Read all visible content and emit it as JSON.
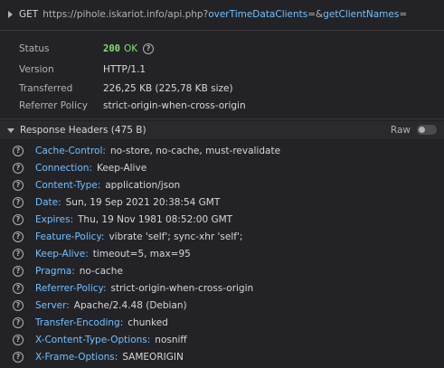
{
  "request": {
    "method": "GET",
    "url_base": "https://pihole.iskariot.info/api.php?",
    "param1": "overTimeDataClients",
    "eq1": "=&",
    "param2": "getClientNames",
    "eq2": "="
  },
  "summary": {
    "status_label": "Status",
    "status_code": "200",
    "status_text": "OK",
    "version_label": "Version",
    "version_value": "HTTP/1.1",
    "transferred_label": "Transferred",
    "transferred_value": "226,25 KB (225,78 KB size)",
    "referrer_label": "Referrer Policy",
    "referrer_value": "strict-origin-when-cross-origin"
  },
  "response_headers": {
    "title": "Response Headers (475 B)",
    "raw_label": "Raw",
    "raw_enabled": false,
    "rows": [
      {
        "name": "Cache-Control:",
        "value": "no-store, no-cache, must-revalidate"
      },
      {
        "name": "Connection:",
        "value": "Keep-Alive"
      },
      {
        "name": "Content-Type:",
        "value": "application/json"
      },
      {
        "name": "Date:",
        "value": "Sun, 19 Sep 2021 20:38:54 GMT"
      },
      {
        "name": "Expires:",
        "value": "Thu, 19 Nov 1981 08:52:00 GMT"
      },
      {
        "name": "Feature-Policy:",
        "value": "vibrate 'self'; sync-xhr 'self';"
      },
      {
        "name": "Keep-Alive:",
        "value": "timeout=5, max=95"
      },
      {
        "name": "Pragma:",
        "value": "no-cache"
      },
      {
        "name": "Referrer-Policy:",
        "value": "strict-origin-when-cross-origin"
      },
      {
        "name": "Server:",
        "value": "Apache/2.4.48 (Debian)"
      },
      {
        "name": "Transfer-Encoding:",
        "value": "chunked"
      },
      {
        "name": "X-Content-Type-Options:",
        "value": "nosniff"
      },
      {
        "name": "X-Frame-Options:",
        "value": "SAMEORIGIN"
      }
    ]
  },
  "icons": {
    "help": "?"
  },
  "colors": {
    "background": "#232327",
    "header_name": "#75bfff",
    "status_ok": "#86de74"
  }
}
